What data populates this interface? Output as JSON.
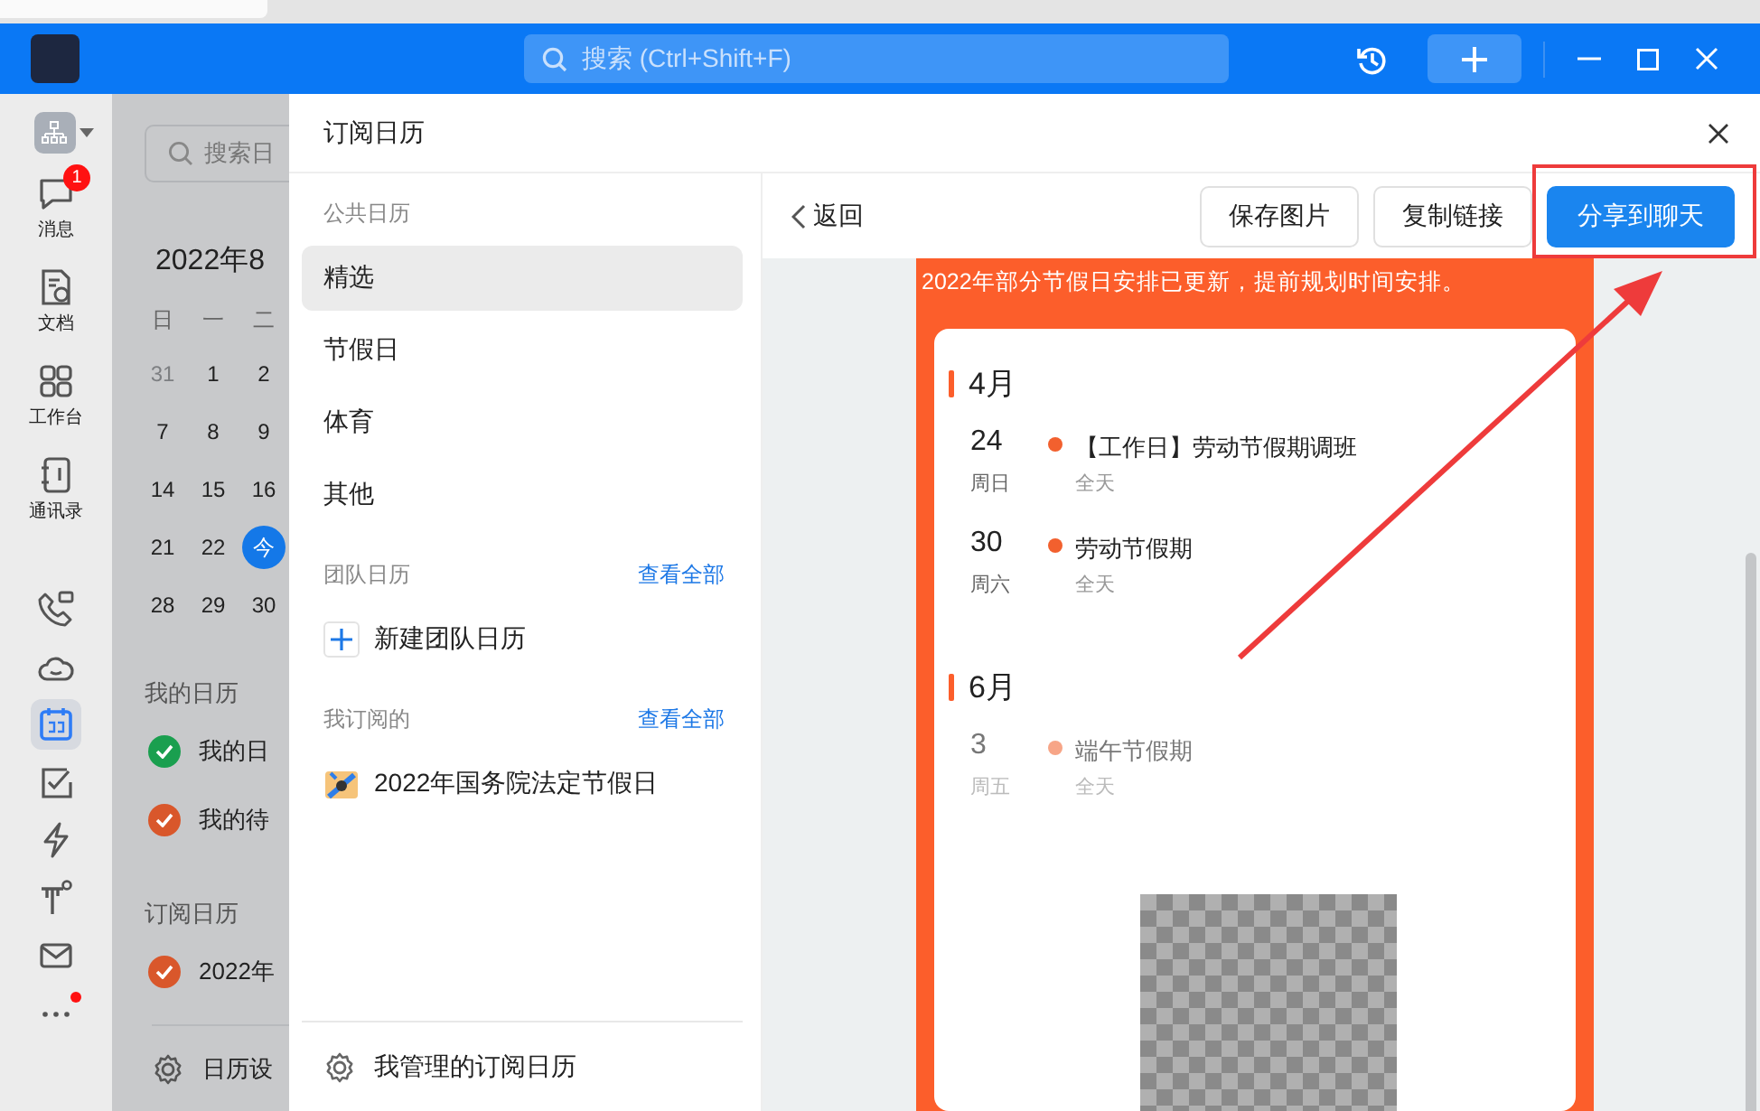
{
  "titlebar": {
    "search_placeholder": "搜索 (Ctrl+Shift+F)"
  },
  "rail": {
    "items": [
      {
        "kind": "chat",
        "label": "消息",
        "badge": "1",
        "selected": false,
        "dot": false
      },
      {
        "kind": "doc",
        "label": "文档",
        "selected": false,
        "dot": false
      },
      {
        "kind": "apps",
        "label": "工作台",
        "selected": false,
        "dot": false
      },
      {
        "kind": "contacts",
        "label": "通讯录",
        "selected": false,
        "dot": false
      },
      {
        "kind": "phone",
        "selected": false,
        "dot": false
      },
      {
        "kind": "cloud",
        "selected": false,
        "dot": false
      },
      {
        "kind": "calendar",
        "selected": true,
        "dot": false
      },
      {
        "kind": "todo",
        "selected": false,
        "dot": false
      },
      {
        "kind": "bolt",
        "selected": false,
        "dot": false
      },
      {
        "kind": "pin",
        "selected": false,
        "dot": false
      },
      {
        "kind": "mail",
        "selected": false,
        "dot": false
      },
      {
        "kind": "more",
        "selected": false,
        "dot": true
      }
    ]
  },
  "calendar_panel": {
    "search_placeholder": "搜索日",
    "month": "2022年8",
    "weekdays": [
      "日",
      "一",
      "二"
    ],
    "weeks": [
      [
        {
          "day": "31",
          "muted": true,
          "selected": false
        },
        {
          "day": "1",
          "muted": false,
          "selected": false
        },
        {
          "day": "2",
          "muted": false,
          "selected": false
        }
      ],
      [
        {
          "day": "7",
          "muted": false,
          "selected": false
        },
        {
          "day": "8",
          "muted": false,
          "selected": false
        },
        {
          "day": "9",
          "muted": false,
          "selected": false
        }
      ],
      [
        {
          "day": "14",
          "muted": false,
          "selected": false
        },
        {
          "day": "15",
          "muted": false,
          "selected": false
        },
        {
          "day": "16",
          "muted": false,
          "selected": false
        }
      ],
      [
        {
          "day": "21",
          "muted": false,
          "selected": false
        },
        {
          "day": "22",
          "muted": false,
          "selected": false
        },
        {
          "day": "今",
          "muted": false,
          "selected": true
        }
      ],
      [
        {
          "day": "28",
          "muted": false,
          "selected": false
        },
        {
          "day": "29",
          "muted": false,
          "selected": false
        },
        {
          "day": "30",
          "muted": false,
          "selected": false
        }
      ]
    ],
    "groups": [
      {
        "title": "我的日历",
        "items": [
          {
            "label": "我的日",
            "color": "#1a9f4f",
            "checked": true
          },
          {
            "label": "我的待",
            "color": "#d9572b",
            "checked": true
          }
        ]
      },
      {
        "title": "订阅日历",
        "items": [
          {
            "label": "2022年",
            "color": "#d9572b",
            "checked": true
          }
        ]
      }
    ],
    "settings": "日历设"
  },
  "modal": {
    "title": "订阅日历",
    "sections": [
      {
        "title": "公共日历",
        "items": [
          {
            "kind": "plain",
            "label": "精选",
            "selected": true
          },
          {
            "kind": "plain",
            "label": "节假日",
            "selected": false
          },
          {
            "kind": "plain",
            "label": "体育",
            "selected": false
          },
          {
            "kind": "plain",
            "label": "其他",
            "selected": false
          }
        ]
      },
      {
        "title": "团队日历",
        "link": "查看全部",
        "items": [
          {
            "kind": "add",
            "label": "新建团队日历",
            "selected": false
          }
        ]
      },
      {
        "title": "我订阅的",
        "link": "查看全部",
        "items": [
          {
            "kind": "calendar",
            "label": "2022年国务院法定节假日",
            "selected": false
          }
        ]
      }
    ],
    "footer": "我管理的订阅日历",
    "back": "返回",
    "buttons": [
      {
        "label": "保存图片",
        "primary": false
      },
      {
        "label": "复制链接",
        "primary": false
      },
      {
        "label": "分享到聊天",
        "primary": true
      }
    ],
    "poster": {
      "notice": "2022年部分节假日安排已更新，提前规划时间安排。",
      "months": [
        {
          "title": "4月",
          "events": [
            {
              "day": "24",
              "weekday": "周日",
              "title": "【工作日】劳动节假期调班",
              "time": "全天",
              "past": false,
              "color": "#f2602e"
            },
            {
              "day": "30",
              "weekday": "周六",
              "title": "劳动节假期",
              "time": "全天",
              "past": false,
              "color": "#f2602e"
            }
          ]
        },
        {
          "title": "6月",
          "events": [
            {
              "day": "3",
              "weekday": "周五",
              "title": "端午节假期",
              "time": "全天",
              "past": true,
              "color": "#f7a587"
            }
          ]
        }
      ]
    }
  }
}
